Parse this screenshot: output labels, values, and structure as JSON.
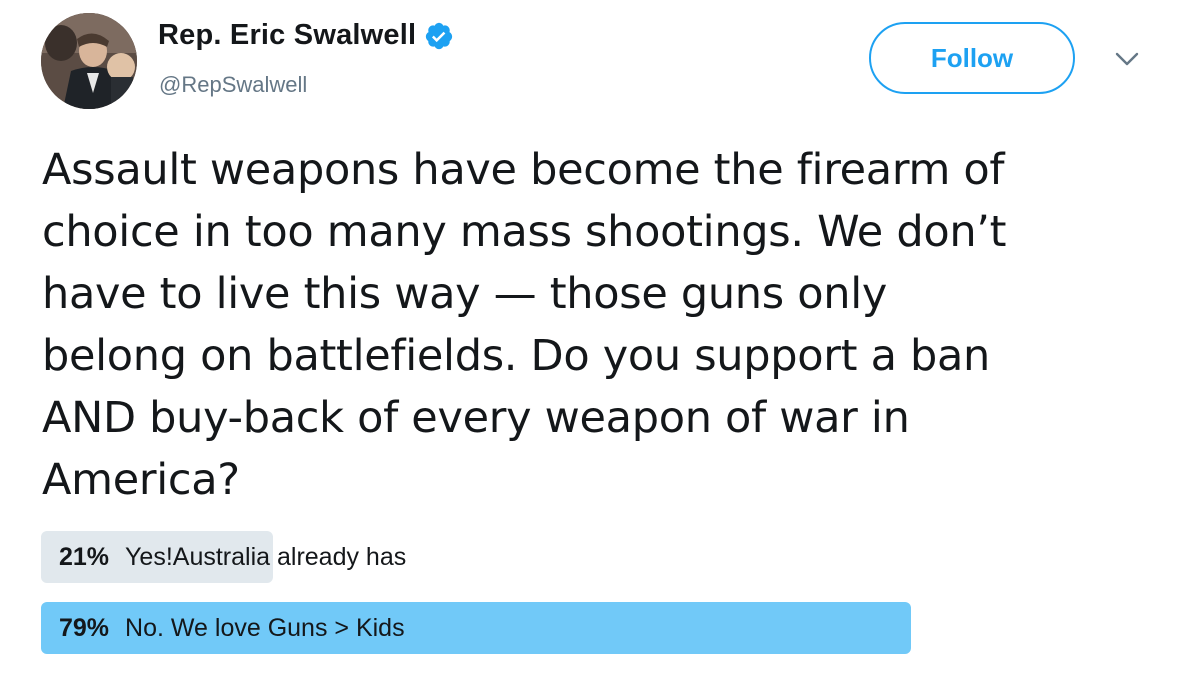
{
  "author": {
    "display_name": "Rep. Eric Swalwell",
    "handle": "@RepSwalwell",
    "verified": true,
    "avatar": "profile-photo"
  },
  "actions": {
    "follow_label": "Follow",
    "more_icon": "chevron-down-icon"
  },
  "tweet": {
    "text": "Assault weapons have become the firearm of\nchoice in too many mass shootings. We don’t\nhave to live this way — those guns only\nbelong on battlefields. Do you support a ban\nAND buy-back of every weapon of war in\nAmerica?"
  },
  "poll": {
    "choices": [
      {
        "percent_label": "21%",
        "percent": 21,
        "label": "Yes!Australia already has",
        "color": "#e1e8ed",
        "winner": false
      },
      {
        "percent_label": "79%",
        "percent": 79,
        "label": "No. We love Guns > Kids",
        "color": "#71c9f8",
        "winner": true
      }
    ]
  },
  "colors": {
    "accent": "#1da1f2",
    "text": "#14171a",
    "secondary_text": "#657786"
  }
}
